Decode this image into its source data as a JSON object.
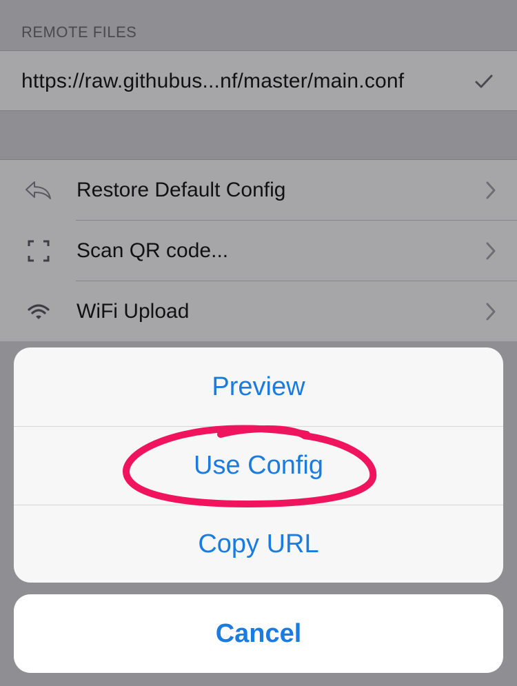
{
  "remote_files": {
    "header": "REMOTE FILES",
    "url": "https://raw.githubus...nf/master/main.conf",
    "selected_icon": "checkmark-icon"
  },
  "actions": [
    {
      "label": "Restore Default Config",
      "icon": "reply-arrow-icon"
    },
    {
      "label": "Scan QR code...",
      "icon": "qr-scan-frame-icon"
    },
    {
      "label": "WiFi Upload",
      "icon": "wifi-icon"
    }
  ],
  "action_sheet": {
    "options": [
      {
        "label": "Preview"
      },
      {
        "label": "Use Config"
      },
      {
        "label": "Copy URL"
      }
    ],
    "cancel_label": "Cancel"
  },
  "colors": {
    "accent": "#1a7be0",
    "annotation": "#f0145e"
  }
}
